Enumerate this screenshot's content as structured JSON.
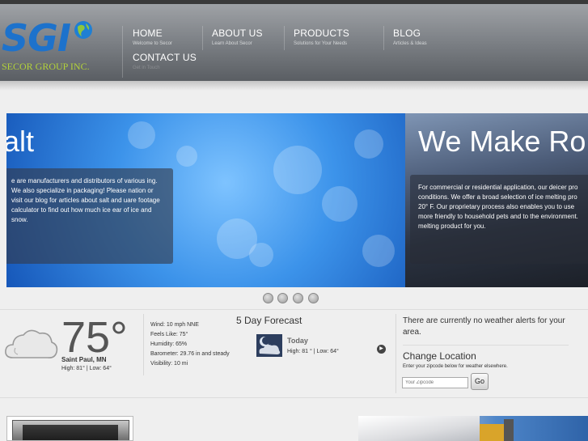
{
  "header": {
    "logo": {
      "letters": "SGI",
      "tagline": "SECOR GROUP INC."
    },
    "nav": [
      {
        "label": "HOME",
        "sub": "Welcome to Secor"
      },
      {
        "label": "ABOUT US",
        "sub": "Learn About Secor"
      },
      {
        "label": "PRODUCTS",
        "sub": "Solutions for Your Needs"
      },
      {
        "label": "BLOG",
        "sub": "Articles & Ideas"
      },
      {
        "label": "CONTACT US",
        "sub": "Get in Touch"
      }
    ]
  },
  "slider": {
    "slides": [
      {
        "title": "alt",
        "text": "e are manufacturers and distributors of various ing. We also specialize in packaging! Please nation or visit our blog for articles about salt and uare footage calculator to find out how much ice ear of ice and snow."
      },
      {
        "title": "We Make Ro",
        "text": "For commercial or residential application, our deicer pro conditions. We offer a broad selection of ice melting pro 20° F. Our proprietary process also enables you to use more friendly to household pets and to the environment. melting product for you."
      }
    ],
    "dot_count": 4
  },
  "weather": {
    "temp": "75°",
    "city": "Saint Paul, MN",
    "hilo": "High: 81° | Low: 64°",
    "details": [
      "Wind: 10 mph NNE",
      "Feels Like: 75°",
      "Humidity: 65%",
      "Barometer: 29.76 in and steady",
      "Visibility: 10 mi"
    ],
    "forecast_title": "5 Day Forecast",
    "today_label": "Today",
    "today_hilo": "High: 81 ° | Low: 64°",
    "alerts": "There are currently no weather alerts for your area.",
    "change_location": "Change Location",
    "zip_hint": "Enter your zipcode below for weather elsewhere.",
    "zip_placeholder": "Your Zipcode",
    "go_label": "Go"
  }
}
